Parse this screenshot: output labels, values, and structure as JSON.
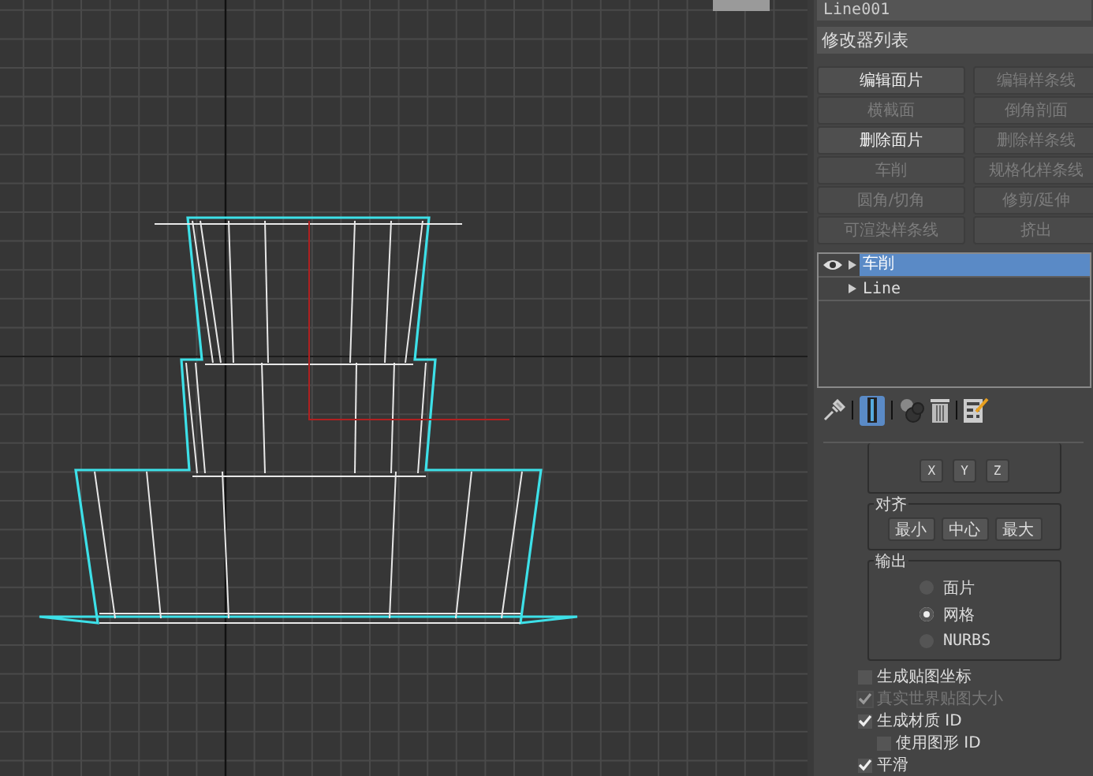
{
  "object_name": "Line001",
  "modifier_list": {
    "label": "修改器列表"
  },
  "modifier_buttons": [
    {
      "label": "编辑面片",
      "disabled": false
    },
    {
      "label": "编辑样条线",
      "disabled": true
    },
    {
      "label": "横截面",
      "disabled": true
    },
    {
      "label": "倒角剖面",
      "disabled": true
    },
    {
      "label": "删除面片",
      "disabled": false
    },
    {
      "label": "删除样条线",
      "disabled": true
    },
    {
      "label": "车削",
      "disabled": true
    },
    {
      "label": "规格化样条线",
      "disabled": true
    },
    {
      "label": "圆角/切角",
      "disabled": true
    },
    {
      "label": "修剪/延伸",
      "disabled": true
    },
    {
      "label": "可渲染样条线",
      "disabled": true
    },
    {
      "label": "挤出",
      "disabled": true
    }
  ],
  "stack": [
    {
      "label": "车削",
      "selected": true,
      "visible": true
    },
    {
      "label": "Line",
      "selected": false,
      "visible": false
    }
  ],
  "stack_toolbar": {
    "show_end_result": {
      "on": true
    }
  },
  "axis_buttons": [
    "X",
    "Y",
    "Z"
  ],
  "align": {
    "title": "对齐",
    "buttons": [
      "最小",
      "中心",
      "最大"
    ]
  },
  "output": {
    "title": "输出",
    "options": [
      {
        "label": "面片",
        "selected": false
      },
      {
        "label": "网格",
        "selected": true
      },
      {
        "label": "NURBS",
        "selected": false
      }
    ]
  },
  "options": [
    {
      "label": "生成贴图坐标",
      "checked": false,
      "disabled": false
    },
    {
      "label": "真实世界贴图大小",
      "checked": true,
      "disabled": true
    },
    {
      "label": "生成材质 ID",
      "checked": true,
      "disabled": false,
      "children": [
        {
          "label": "使用图形 ID",
          "checked": false,
          "disabled": false
        }
      ]
    },
    {
      "label": "平滑",
      "checked": true,
      "disabled": false
    }
  ]
}
